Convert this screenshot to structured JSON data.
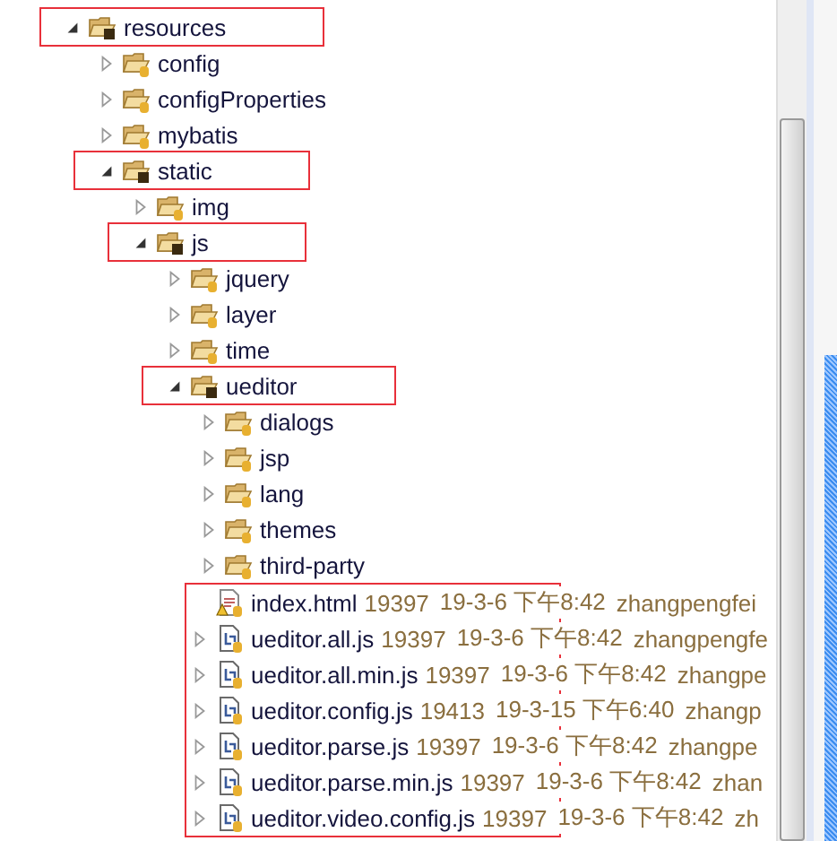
{
  "tree": [
    {
      "label": "resources",
      "kind": "folder",
      "expanded": true,
      "highlighted": true,
      "children": [
        {
          "label": "config",
          "kind": "folder",
          "expanded": false,
          "highlighted": false
        },
        {
          "label": "configProperties",
          "kind": "folder",
          "expanded": false,
          "highlighted": false
        },
        {
          "label": "mybatis",
          "kind": "folder",
          "expanded": false,
          "highlighted": false
        },
        {
          "label": "static",
          "kind": "folder",
          "expanded": true,
          "highlighted": true,
          "children": [
            {
              "label": "img",
              "kind": "folder",
              "expanded": false,
              "highlighted": false
            },
            {
              "label": "js",
              "kind": "folder",
              "expanded": true,
              "highlighted": true,
              "children": [
                {
                  "label": "jquery",
                  "kind": "folder",
                  "expanded": false,
                  "highlighted": false
                },
                {
                  "label": "layer",
                  "kind": "folder",
                  "expanded": false,
                  "highlighted": false
                },
                {
                  "label": "time",
                  "kind": "folder",
                  "expanded": false,
                  "highlighted": false
                },
                {
                  "label": "ueditor",
                  "kind": "folder",
                  "expanded": true,
                  "highlighted": true,
                  "files_highlighted": true,
                  "children": [
                    {
                      "label": "dialogs",
                      "kind": "folder",
                      "expanded": false,
                      "highlighted": false
                    },
                    {
                      "label": "jsp",
                      "kind": "folder",
                      "expanded": false,
                      "highlighted": false
                    },
                    {
                      "label": "lang",
                      "kind": "folder",
                      "expanded": false,
                      "highlighted": false
                    },
                    {
                      "label": "themes",
                      "kind": "folder",
                      "expanded": false,
                      "highlighted": false
                    },
                    {
                      "label": "third-party",
                      "kind": "folder",
                      "expanded": false,
                      "highlighted": false
                    },
                    {
                      "label": "index.html",
                      "kind": "html",
                      "size": "19397",
                      "date": "19-3-6 下午8:42",
                      "author": "zhangpengfei"
                    },
                    {
                      "label": "ueditor.all.js",
                      "kind": "js",
                      "expanded": false,
                      "size": "19397",
                      "date": "19-3-6 下午8:42",
                      "author": "zhangpengfe"
                    },
                    {
                      "label": "ueditor.all.min.js",
                      "kind": "js",
                      "expanded": false,
                      "size": "19397",
                      "date": "19-3-6 下午8:42",
                      "author": "zhangpe"
                    },
                    {
                      "label": "ueditor.config.js",
                      "kind": "js",
                      "expanded": false,
                      "size": "19413",
                      "date": "19-3-15 下午6:40",
                      "author": "zhangp"
                    },
                    {
                      "label": "ueditor.parse.js",
                      "kind": "js",
                      "expanded": false,
                      "size": "19397",
                      "date": "19-3-6 下午8:42",
                      "author": "zhangpe"
                    },
                    {
                      "label": "ueditor.parse.min.js",
                      "kind": "js",
                      "expanded": false,
                      "size": "19397",
                      "date": "19-3-6 下午8:42",
                      "author": "zhan"
                    },
                    {
                      "label": "ueditor.video.config.js",
                      "kind": "js",
                      "expanded": false,
                      "size": "19397",
                      "date": "19-3-6 下午8:42",
                      "author": "zh"
                    }
                  ]
                }
              ]
            }
          ]
        }
      ]
    }
  ]
}
